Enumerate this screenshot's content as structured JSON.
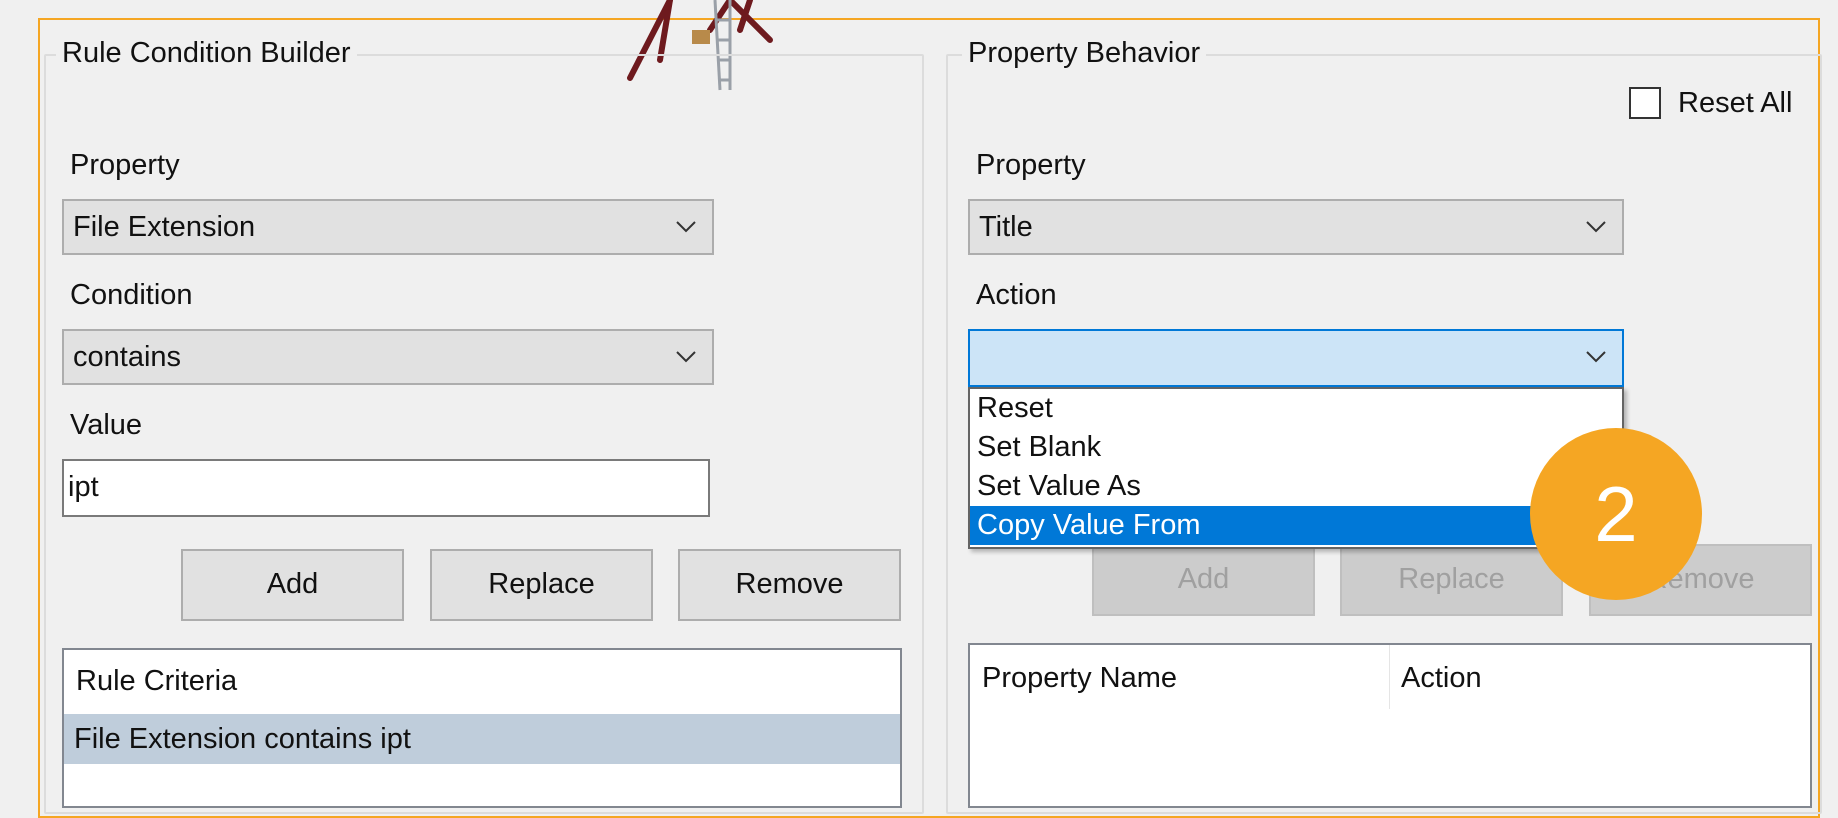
{
  "left_group": {
    "title": "Rule Condition Builder",
    "property_label": "Property",
    "property_value": "File Extension",
    "condition_label": "Condition",
    "condition_value": "contains",
    "value_label": "Value",
    "value_text": "ipt",
    "buttons": {
      "add": "Add",
      "replace": "Replace",
      "remove": "Remove"
    },
    "criteria_list": {
      "header": "Rule Criteria",
      "rows": [
        "File Extension contains ipt"
      ]
    }
  },
  "right_group": {
    "title": "Property Behavior",
    "reset_all_label": "Reset All",
    "property_label": "Property",
    "property_value": "Title",
    "action_label": "Action",
    "action_value": "",
    "action_options": [
      "Reset",
      "Set Blank",
      "Set Value As",
      "Copy Value From"
    ],
    "action_selected_option": "Copy Value From",
    "buttons": {
      "add": "Add",
      "replace": "Replace",
      "remove": "Remove"
    },
    "behavior_list": {
      "headers": [
        "Property Name",
        "Action"
      ]
    }
  },
  "badge": {
    "number": "2",
    "color": "#f5a623"
  },
  "colors": {
    "accent_orange": "#f5a623",
    "focus_blue": "#0078d7",
    "selection_gray_blue": "#bfcddb"
  }
}
